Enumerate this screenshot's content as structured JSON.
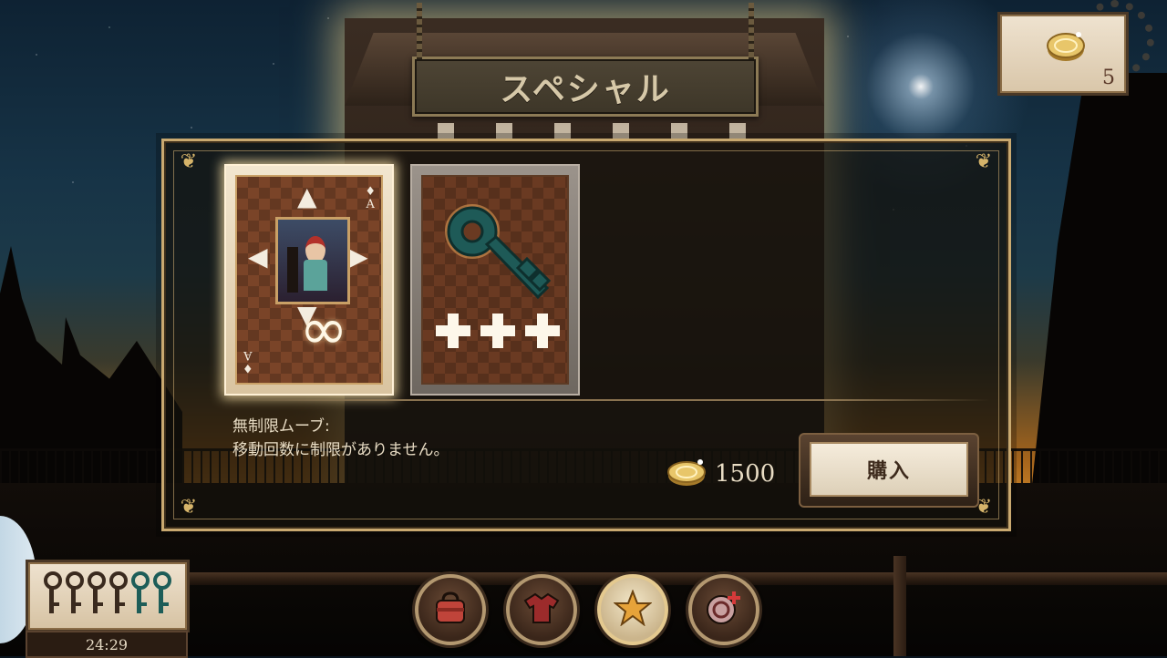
{
  "header": {
    "title": "スペシャル"
  },
  "currency": {
    "coins": "5"
  },
  "special_items": [
    {
      "name": "unlimited-moves",
      "selected": true
    },
    {
      "name": "extra-keys",
      "selected": false
    }
  ],
  "item_detail": {
    "line1": "無制限ムーブ:",
    "line2": "移動回数に制限がありません。",
    "price": "1500",
    "buy_label": "購入"
  },
  "status": {
    "keys_total": 6,
    "keys_remaining": 2,
    "timer": "24:29"
  },
  "bottom_menu": [
    {
      "name": "bag",
      "icon": "bag-icon",
      "active": false
    },
    {
      "name": "outfit",
      "icon": "shirt-icon",
      "active": false
    },
    {
      "name": "special",
      "icon": "star-icon",
      "active": true
    },
    {
      "name": "add-coins",
      "icon": "coin-plus-icon",
      "active": false
    }
  ],
  "colors": {
    "panel_border": "#c9a970",
    "key_teal": "#1d5d58",
    "paper": "#efe3d0"
  }
}
